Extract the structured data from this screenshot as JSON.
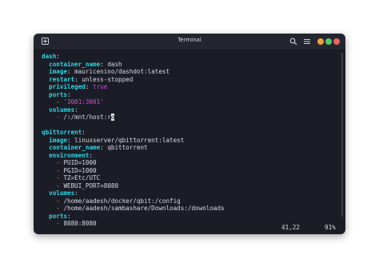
{
  "window": {
    "title": "Terminal"
  },
  "icons": {
    "new_tab": "new-tab-icon",
    "search": "search-icon",
    "menu": "menu-icon",
    "minimize": "minimize-icon",
    "maximize": "maximize-icon",
    "close": "close-icon"
  },
  "colors": {
    "background": "#1b1d26",
    "key": "#2ad7e6",
    "dash": "#f28a3a",
    "string": "#d44cd8",
    "minimize": "#f0a33c",
    "maximize": "#4fd06a",
    "close": "#f0625a"
  },
  "editor": {
    "lines": [
      {
        "indent": "",
        "key": "dash",
        "sep": ":",
        "value": "",
        "kind": "k0"
      },
      {
        "indent": "  ",
        "key": "container_name",
        "sep": ":",
        "value": " dash",
        "kind": "k1"
      },
      {
        "indent": "  ",
        "key": "image",
        "sep": ":",
        "value": " mauricenino/dashdot:latest",
        "kind": "k1"
      },
      {
        "indent": "  ",
        "key": "restart",
        "sep": ":",
        "value": " unless-stopped",
        "kind": "k1"
      },
      {
        "indent": "  ",
        "key": "privileged",
        "sep": ":",
        "value": " true",
        "kind": "k1",
        "value_class": "bool"
      },
      {
        "indent": "  ",
        "key": "ports",
        "sep": ":",
        "value": "",
        "kind": "k1"
      },
      {
        "indent": "    ",
        "dash": "- ",
        "value": "'3001:3001'",
        "kind": "item",
        "value_class": "str"
      },
      {
        "indent": "  ",
        "key": "volumes",
        "sep": ":",
        "value": "",
        "kind": "k1"
      },
      {
        "indent": "    ",
        "dash": "- ",
        "value": "/:/mnt/host:r",
        "cursor": "o",
        "after": "",
        "kind": "item"
      },
      {
        "indent": "",
        "key": "",
        "sep": "",
        "value": "",
        "kind": "blank"
      },
      {
        "indent": "",
        "key": "qbittorrent",
        "sep": ":",
        "value": "",
        "kind": "k0"
      },
      {
        "indent": "  ",
        "key": "image",
        "sep": ":",
        "value": " linuxserver/qbittorrent:latest",
        "kind": "k1"
      },
      {
        "indent": "  ",
        "key": "container_name",
        "sep": ":",
        "value": " qbittorrent",
        "kind": "k1"
      },
      {
        "indent": "  ",
        "key": "environment",
        "sep": ":",
        "value": "",
        "kind": "k1"
      },
      {
        "indent": "    ",
        "dash": "- ",
        "value": "PUID=1000",
        "kind": "item"
      },
      {
        "indent": "    ",
        "dash": "- ",
        "value": "PGID=1000",
        "kind": "item"
      },
      {
        "indent": "    ",
        "dash": "- ",
        "value": "TZ=Etc/UTC",
        "kind": "item"
      },
      {
        "indent": "    ",
        "dash": "- ",
        "value": "WEBUI_PORT=8080",
        "kind": "item"
      },
      {
        "indent": "  ",
        "key": "volumes",
        "sep": ":",
        "value": "",
        "kind": "k1"
      },
      {
        "indent": "    ",
        "dash": "- ",
        "value": "/home/aadesh/docker/qbit:/config",
        "kind": "item"
      },
      {
        "indent": "    ",
        "dash": "- ",
        "value": "/home/aadesh/sambashare/Downloads:/downloads",
        "kind": "item"
      },
      {
        "indent": "  ",
        "key": "ports",
        "sep": ":",
        "value": "",
        "kind": "k1"
      },
      {
        "indent": "    ",
        "dash": "- ",
        "value": "8080:8080",
        "kind": "item"
      }
    ]
  },
  "status": {
    "position": "41,22",
    "percent": "91%"
  }
}
